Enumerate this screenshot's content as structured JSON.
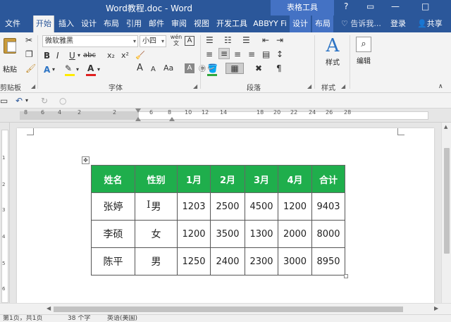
{
  "titlebar": {
    "doc_title": "Word教程.doc - Word",
    "tool_title": "表格工具",
    "help_icon": "?",
    "restore_icon": "□",
    "minimize_icon": "—"
  },
  "tabs": [
    {
      "label": "文件"
    },
    {
      "label": "开始"
    },
    {
      "label": "插入"
    },
    {
      "label": "设计"
    },
    {
      "label": "布局"
    },
    {
      "label": "引用"
    },
    {
      "label": "邮件"
    },
    {
      "label": "审阅"
    },
    {
      "label": "视图"
    },
    {
      "label": "开发工具"
    },
    {
      "label": "ABBYY Fi"
    },
    {
      "label": "设计"
    },
    {
      "label": "布局"
    }
  ],
  "tellme": "♡ 告诉我...",
  "login": "登录",
  "share": "共享",
  "ribbon": {
    "clipboard": {
      "paste_label": "粘贴",
      "group_label": "剪贴板"
    },
    "font": {
      "font_name": "微软雅黑",
      "font_size": "小四",
      "wen_label": "wén",
      "group_label": "字体",
      "bold": "B",
      "italic": "I",
      "underline": "U",
      "strike": "abc",
      "sub": "x₂",
      "sup": "x²",
      "grow": "A",
      "shrink": "A",
      "case": "Aa"
    },
    "paragraph": {
      "group_label": "段落"
    },
    "styles": {
      "label": "样式",
      "group_label": "样式"
    },
    "editing": {
      "label": "编辑"
    }
  },
  "ruler_ticks": [
    "8",
    "6",
    "4",
    "2",
    "2",
    "6",
    "8",
    "10",
    "12",
    "14",
    "18",
    "20",
    "22",
    "24",
    "26",
    "28"
  ],
  "vruler_ticks": [
    "1",
    "2",
    "3",
    "4",
    "5",
    "6"
  ],
  "table": {
    "headers": [
      "姓名",
      "性别",
      "1月",
      "2月",
      "3月",
      "4月",
      "合计"
    ],
    "rows": [
      [
        "张婷",
        "男",
        "1203",
        "2500",
        "4500",
        "1200",
        "9403"
      ],
      [
        "李硕",
        "女",
        "1200",
        "3500",
        "1300",
        "2000",
        "8000"
      ],
      [
        "陈平",
        "男",
        "1250",
        "2400",
        "2300",
        "3000",
        "8950"
      ]
    ]
  },
  "status": {
    "page": "第1页，共1页",
    "words": "38 个字",
    "lang": "英语(美国)"
  },
  "colors": {
    "word_blue": "#2b579a",
    "header_green": "#1fae4c"
  }
}
